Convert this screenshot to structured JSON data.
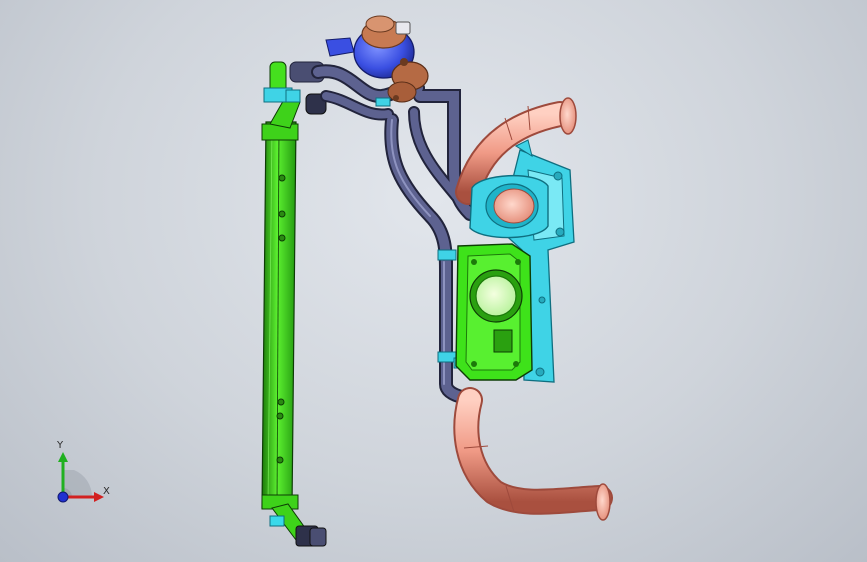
{
  "triad": {
    "x_label": "X",
    "y_label": "Y"
  },
  "colors": {
    "background": "#cfd4db",
    "frame_green": "#45e01e",
    "frame_green_dark": "#1c7a0a",
    "hose_navy": "#4a4e72",
    "hose_navy_dark": "#22243c",
    "pipe_salmon": "#f09a86",
    "pipe_salmon_dark": "#9e4a3c",
    "housing_cyan": "#3fd3e6",
    "housing_cyan_dark": "#0f6f80",
    "motor_blue": "#3a4fe2",
    "motor_copper": "#c77a52",
    "throttle_green": "#3ee21a",
    "axis_x": "#d22020",
    "axis_y": "#20b020",
    "axis_z": "#2030d0"
  },
  "icons": {
    "triad": "xyz-reference-triad-icon"
  }
}
